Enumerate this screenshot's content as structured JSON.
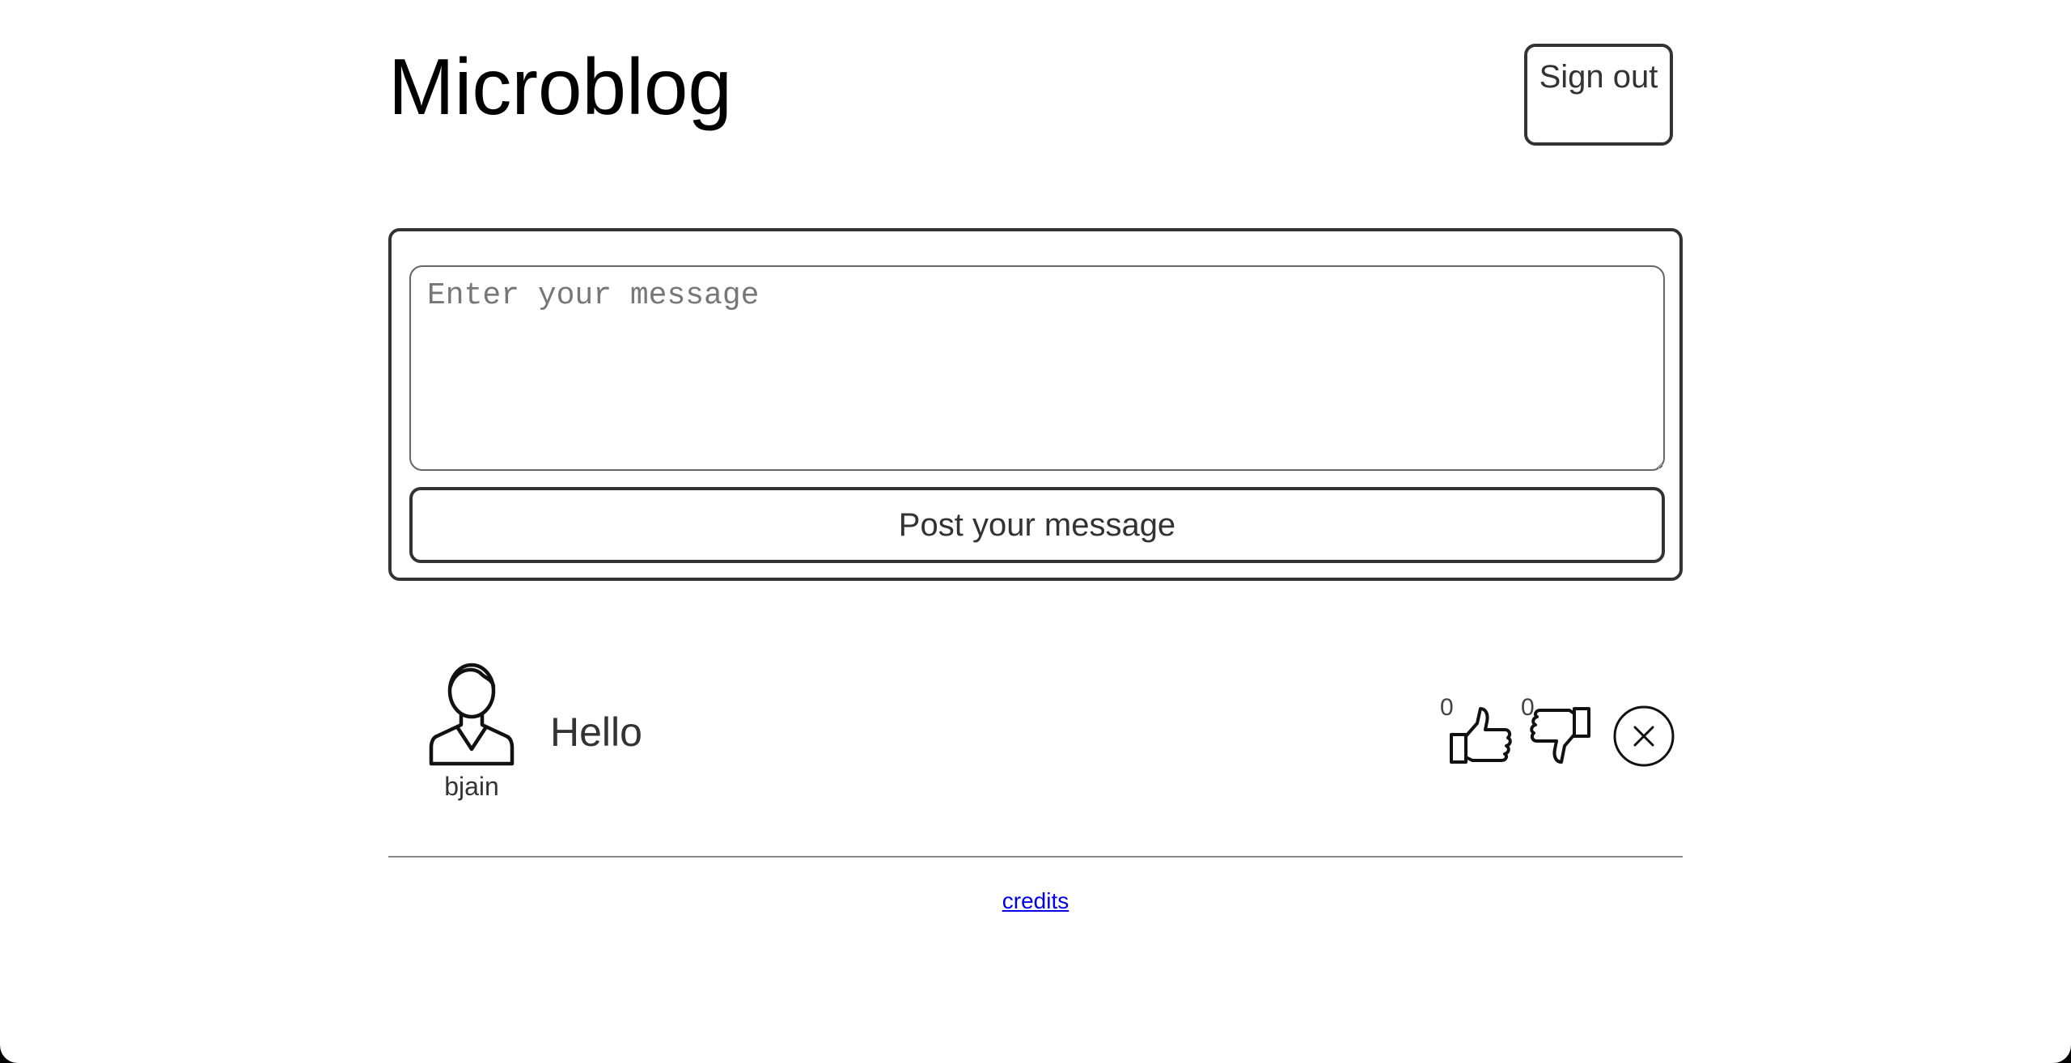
{
  "header": {
    "title": "Microblog",
    "sign_out_label": "Sign out"
  },
  "composer": {
    "placeholder": "Enter your message",
    "value": "",
    "post_button_label": "Post your message"
  },
  "posts": [
    {
      "username": "bjain",
      "text": "Hello",
      "likes": "0",
      "dislikes": "0",
      "icons": {
        "avatar": "user-avatar-icon",
        "like": "thumbs-up-icon",
        "dislike": "thumbs-down-icon",
        "delete": "close-circle-icon"
      }
    }
  ],
  "footer": {
    "credits_label": "credits"
  },
  "colors": {
    "background": "#ffffff",
    "text": "#333333",
    "border": "#333333",
    "link": "#0000ee"
  }
}
